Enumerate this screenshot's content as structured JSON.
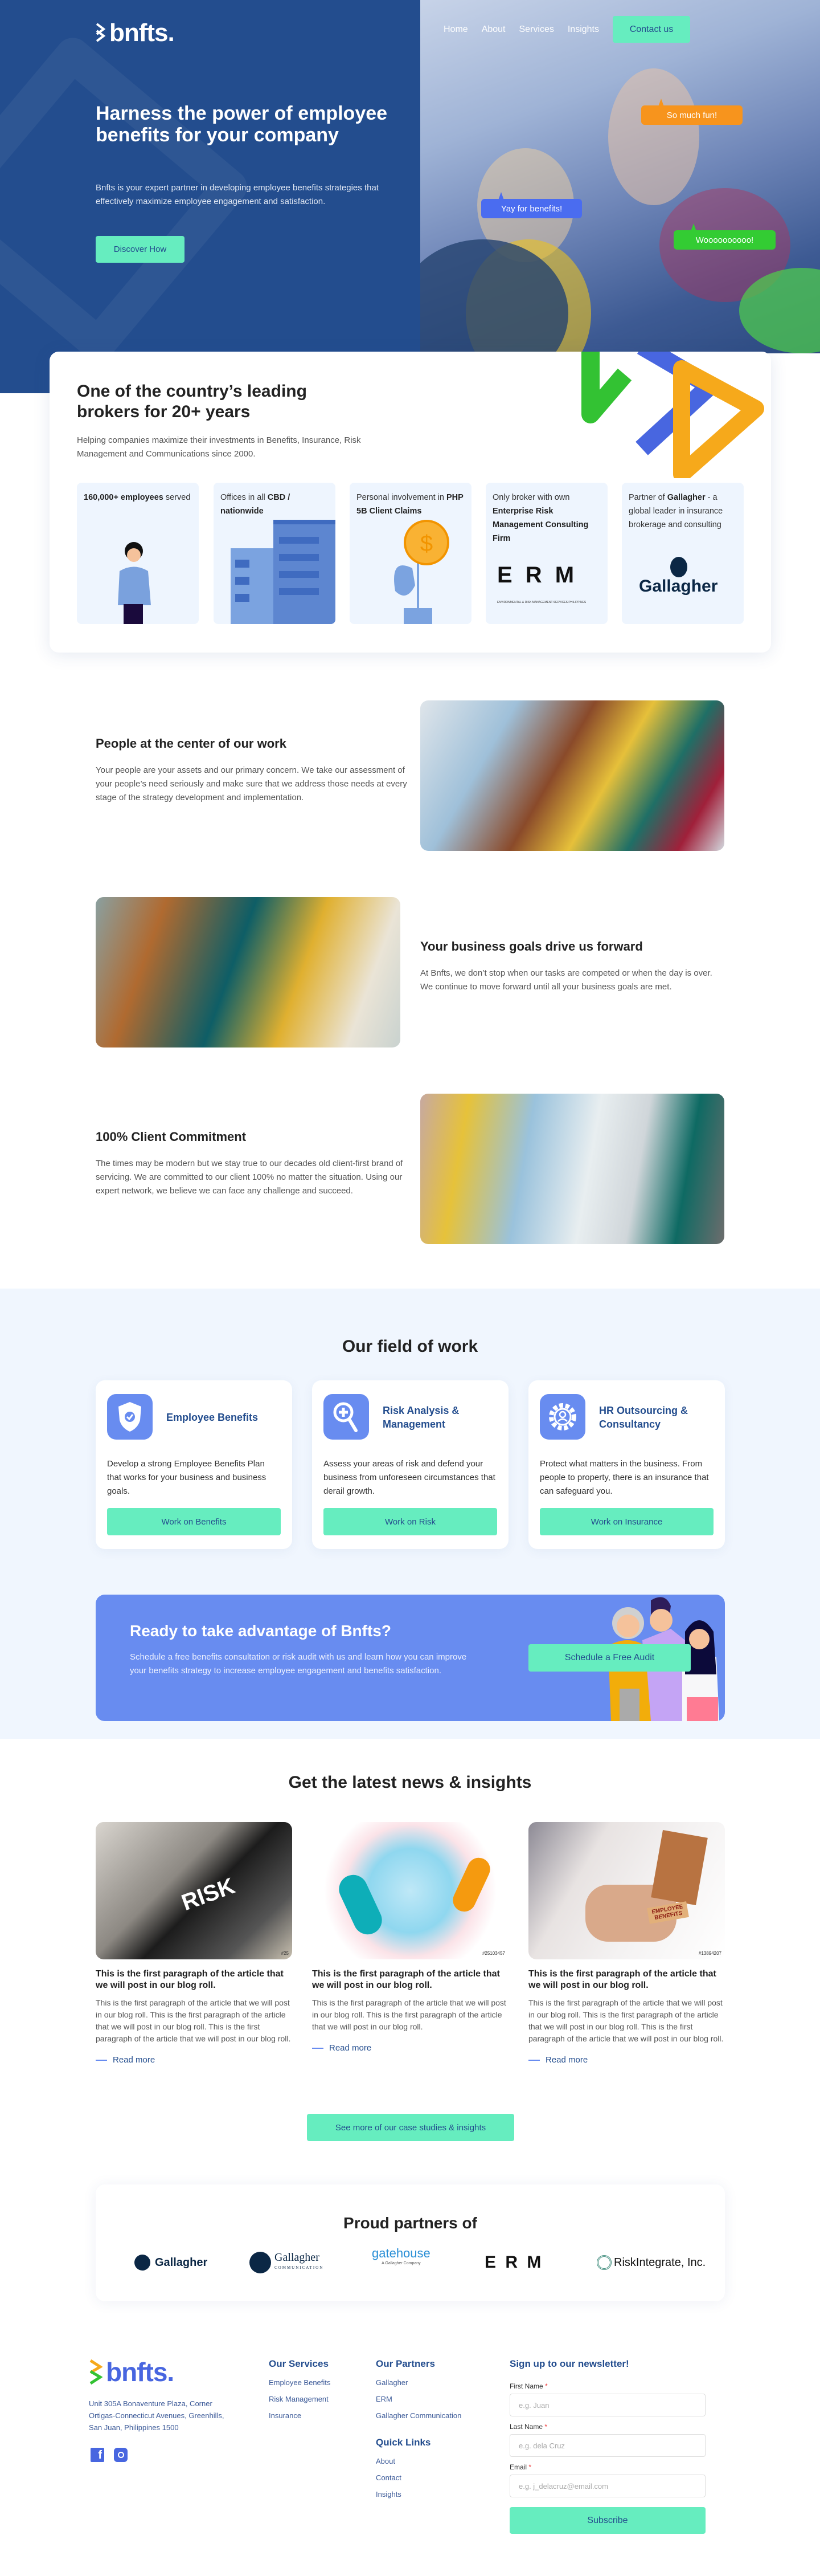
{
  "header": {
    "logo": "bnfts.",
    "nav": [
      "Home",
      "About",
      "Services",
      "Insights"
    ],
    "contact": "Contact us"
  },
  "hero": {
    "title": "Harness the power of employee benefits for your company",
    "text": "Bnfts is your expert partner in developing employee benefits strategies that effectively maximize employee engagement and satisfaction.",
    "cta": "Discover How",
    "bubbles": [
      "So much fun!",
      "Yay for benefits!",
      "Woooooooooo!"
    ],
    "colors": {
      "bg": "#234d8e",
      "mint": "#66edbf"
    }
  },
  "about": {
    "title": "One of the country’s leading brokers for 20+ years",
    "text": "Helping companies maximize their investments in Benefits, Insurance, Risk Management and Communications since 2000.",
    "features": [
      {
        "pre": "",
        "bold": "160,000+ employees",
        "post": " served"
      },
      {
        "pre": "Offices in all ",
        "bold": "CBD / nationwide",
        "post": ""
      },
      {
        "pre": "Personal involvement in ",
        "bold": "PHP 5B Client Claims",
        "post": ""
      },
      {
        "pre": "Only broker with own ",
        "bold": "Enterprise Risk Management Consulting Firm",
        "post": ""
      },
      {
        "pre": "Partner of ",
        "bold": "Gallagher",
        "post": " - a global leader in insurance brokerage and consulting"
      }
    ],
    "erm_logo": "E R M",
    "erm_sub": "ENVIRONMENTAL & RISK MANAGEMENT SERVICES PHILIPPINES",
    "gallagher_logo": "Gallagher"
  },
  "values": [
    {
      "title": "People at the center of our work",
      "text": "Your people are your assets and our primary concern. We take our assessment of your people’s need seriously and make sure that we address those needs at every stage of the strategy development and implementation."
    },
    {
      "title": "Your business goals drive us forward",
      "text": "At Bnfts, we don’t stop when our tasks are competed or when the day is over. We continue to move forward until all your business goals are met."
    },
    {
      "title": "100% Client Commitment",
      "text": "The times may be modern but we stay true to our decades old client-first brand of servicing. We are committed to our client 100% no matter the situation. Using our expert network, we believe we can face any challenge and succeed."
    }
  ],
  "field": {
    "title": "Our field of work",
    "services": [
      {
        "icon": "shield-check-icon",
        "title": "Employee Benefits",
        "text": "Develop a strong Employee Benefits Plan that works for your business and business goals.",
        "button": "Work on Benefits"
      },
      {
        "icon": "magnifier-plus-icon",
        "title": "Risk Analysis & Management",
        "text": "Assess your areas of risk and defend your business from unforeseen circumstances that derail growth.",
        "button": "Work on Risk"
      },
      {
        "icon": "gear-person-icon",
        "title": "HR Outsourcing & Consultancy",
        "text": "Protect what matters in the business. From people to property, there is an insurance that can safeguard you.",
        "button": "Work on Insurance"
      }
    ]
  },
  "cta": {
    "title": "Ready to take advantage of Bnfts?",
    "text": "Schedule a free benefits consultation or risk audit with us and learn how you can improve your benefits strategy to increase employee engagement and benefits satisfaction.",
    "button": "Schedule a Free Audit",
    "color": "#688cf0"
  },
  "news": {
    "title": "Get the latest news & insights",
    "articles": [
      {
        "img_text": "RISK",
        "stock_id": "#25",
        "title": "This is the first paragraph of the article that we will post in our blog roll.",
        "text": "This is the first paragraph of the article that we will post in our blog roll. This is the first paragraph of the article that we will post in our blog roll. This is the first paragraph of the article that we will post in our blog roll.",
        "link": "Read more"
      },
      {
        "img_text": "",
        "stock_id": "#25103457",
        "title": "This is the first paragraph of the article that we will post in our blog roll.",
        "text": "This is the first paragraph of the article that we will post in our blog roll. This is the first paragraph of the article that we will post in our blog roll.",
        "link": "Read more"
      },
      {
        "img_text": "EMPLOYEE BENEFITS",
        "stock_id": "#13894207",
        "title": "This is the first paragraph of the article that we will post in our blog roll.",
        "text": "This is the first paragraph of the article that we will post in our blog roll. This is the first paragraph of the article that we will post in our blog roll. This is the first paragraph of the article that we will post in our blog roll.",
        "link": "Read more"
      }
    ],
    "more": "See more of our case studies & insights"
  },
  "partners": {
    "title": "Proud partners of",
    "logos": [
      "Gallagher",
      "Gallagher",
      "COMMUNICATION",
      "gatehouse",
      "A Gallagher Company",
      "E R M",
      "RiskIntegrate, Inc."
    ]
  },
  "footer": {
    "logo": "bnfts.",
    "address": "Unit 305A Bonaventure Plaza, Corner Ortigas-Connecticut Avenues, Greenhills, San Juan, Philippines 1500",
    "services": {
      "title": "Our Services",
      "links": [
        "Employee Benefits",
        "Risk Management",
        "Insurance"
      ]
    },
    "partners": {
      "title": "Our Partners",
      "links": [
        "Gallagher",
        "ERM",
        "Gallagher Communication"
      ]
    },
    "quick": {
      "title": "Quick Links",
      "links": [
        "About",
        "Contact",
        "Insights"
      ]
    },
    "newsletter": {
      "title": "Sign up to our newsletter!",
      "first_label": "First Name",
      "first_ph": "e.g. Juan",
      "last_label": "Last Name",
      "last_ph": "e.g. dela Cruz",
      "email_label": "Email",
      "email_ph": "e.g. j_delacruz@email.com",
      "required": "*",
      "button": "Subscribe"
    }
  }
}
